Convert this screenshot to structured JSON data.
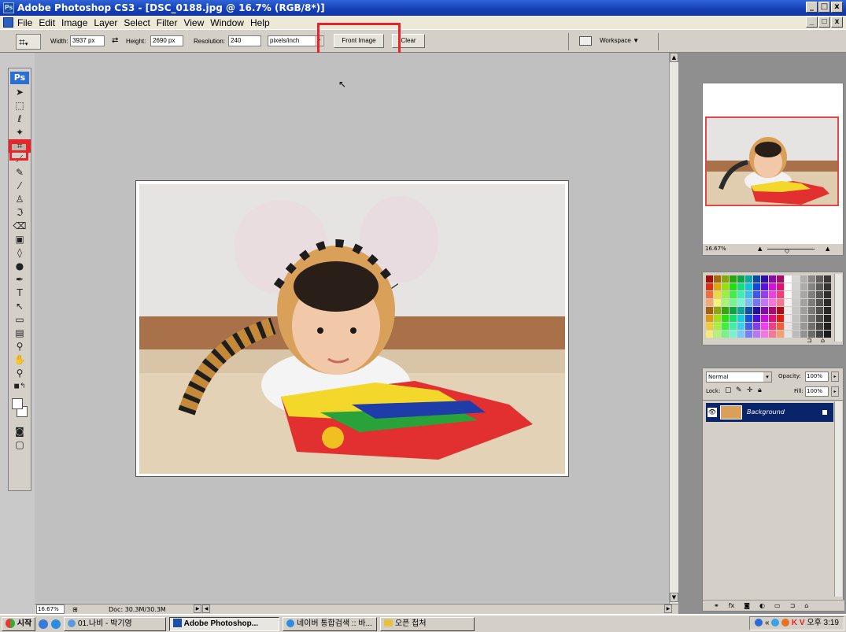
{
  "window": {
    "title": "Adobe Photoshop CS3 - [DSC_0188.jpg @ 16.7% (RGB/8*)]",
    "app_badge": "Ps",
    "min": "_",
    "max": "□",
    "close": "x"
  },
  "menu": [
    "File",
    "Edit",
    "Image",
    "Layer",
    "Select",
    "Filter",
    "View",
    "Window",
    "Help"
  ],
  "options": {
    "width_label": "Width:",
    "width_value": "3937 px",
    "height_label": "Height:",
    "height_value": "2690 px",
    "resolution_label": "Resolution:",
    "resolution_value": "240",
    "unit": "pixels/inch",
    "front_image": "Front Image",
    "clear": "Clear",
    "workspace": "Workspace ▼"
  },
  "toolbox": {
    "logo": "Ps",
    "tools": [
      "move",
      "marquee",
      "lasso",
      "magic-wand",
      "crop",
      "slice",
      "healing",
      "brush",
      "clone-stamp",
      "history-brush",
      "eraser",
      "gradient",
      "blur",
      "dodge",
      "pen",
      "type",
      "path-selection",
      "shape",
      "notes",
      "eyedropper",
      "hand",
      "zoom"
    ]
  },
  "status": {
    "zoom": "16.67%",
    "doc": "Doc: 30.3M/30.3M"
  },
  "navigator": {
    "zoom": "16.67%"
  },
  "layers": {
    "blend_mode": "Normal",
    "opacity_label": "Opacity:",
    "opacity_value": "100%",
    "lock_label": "Lock:",
    "fill_label": "Fill:",
    "fill_value": "100%",
    "layer_name": "Background"
  },
  "taskbar": {
    "start": "시작",
    "items": [
      "01.나비 - 박기영",
      "Adobe Photoshop...",
      "네이버 통합검색 :: 바...",
      "오픈 첩처"
    ],
    "active_index": 1,
    "clock": "오후 3:19"
  },
  "colors": {
    "highlight": "#e8242a",
    "titlebar": "#1841b8",
    "layer_selected": "#0a246a"
  }
}
